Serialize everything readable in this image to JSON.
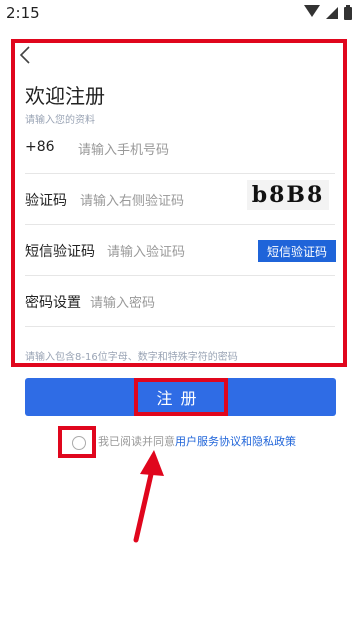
{
  "status": {
    "time": "2:15"
  },
  "page": {
    "title": "欢迎注册",
    "subtitle": "请输入您的资料"
  },
  "form": {
    "phone": {
      "label": "+86",
      "placeholder": "请输入手机号码"
    },
    "captcha": {
      "label": "验证码",
      "placeholder": "请输入右侧验证码",
      "image_text": "b8B8"
    },
    "sms": {
      "label": "短信验证码",
      "placeholder": "请输入验证码",
      "button": "短信验证码"
    },
    "password": {
      "label": "密码设置",
      "placeholder": "请输入密码"
    },
    "hint": "请输入包含8-16位字母、数字和特殊字符的密码"
  },
  "register_button": "注册",
  "agreement": {
    "prefix": "我已阅读并同意",
    "service": "用户服务协议",
    "and": "和",
    "privacy": "隐私政策"
  },
  "colors": {
    "primary": "#2f6ce5",
    "highlight": "#e0061d"
  }
}
